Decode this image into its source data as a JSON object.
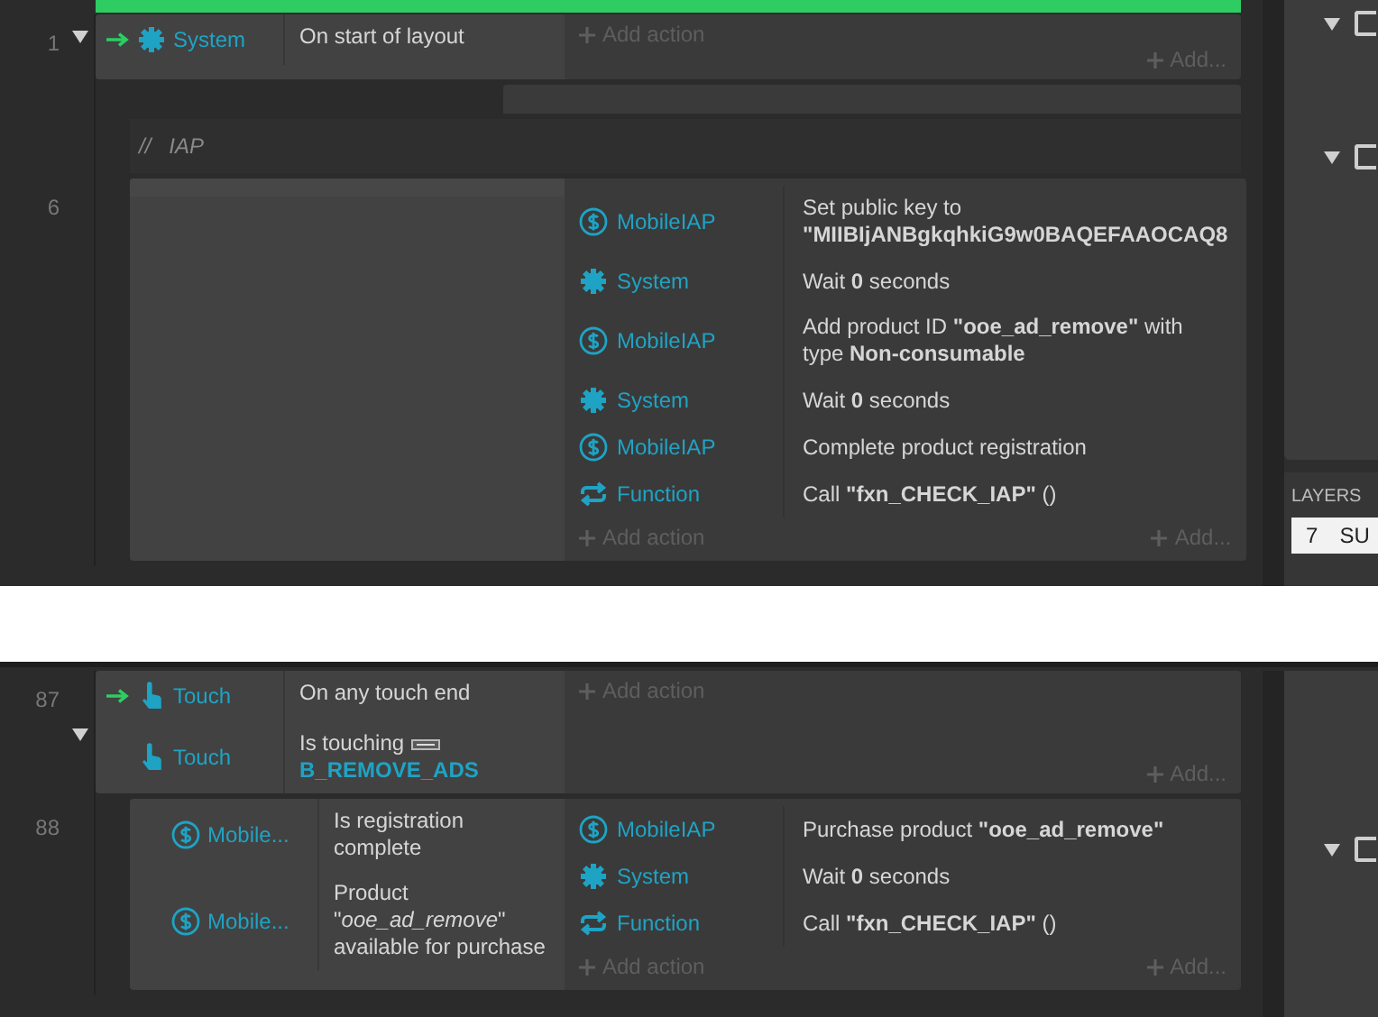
{
  "sections": [
    {
      "group_bar": true,
      "tree_toggles": [
        {
          "expanded": true,
          "checked": false
        },
        {
          "expanded": true,
          "checked": false
        }
      ],
      "layers": {
        "title": "LAYERS",
        "rows": [
          {
            "number": "7",
            "name": "SU",
            "selected": true
          }
        ]
      },
      "events": [
        {
          "kind": "event",
          "line": "1",
          "expanded": true,
          "conditions": [
            {
              "object": "System",
              "kind": "system",
              "trigger": true,
              "text": "On start of layout"
            }
          ],
          "add_action": "Add action",
          "add_more": "Add...",
          "children": [
            {
              "kind": "stub"
            },
            {
              "kind": "comment",
              "marker": "//",
              "text": "IAP"
            },
            {
              "kind": "event",
              "line": "6",
              "actions": [
                {
                  "object": "MobileIAP",
                  "kind": "iap",
                  "text": "Set public key to **\"MIIBIjANBgkqhkiG9w0BAQEFAAOCAQ8**"
                },
                {
                  "object": "System",
                  "kind": "system",
                  "text": "Wait **0** seconds"
                },
                {
                  "object": "MobileIAP",
                  "kind": "iap",
                  "text": "Add product ID **\"ooe_ad_remove\"** with type **Non-consumable**"
                },
                {
                  "object": "System",
                  "kind": "system",
                  "text": "Wait **0** seconds"
                },
                {
                  "object": "MobileIAP",
                  "kind": "iap",
                  "text": "Complete product registration"
                },
                {
                  "object": "Function",
                  "kind": "function",
                  "text": "Call **\"fxn_CHECK_IAP\"** ()"
                }
              ],
              "add_action": "Add action",
              "add_more": "Add..."
            }
          ]
        }
      ]
    },
    {
      "tree_toggles": [
        {
          "expanded": true,
          "checked": false
        }
      ],
      "events": [
        {
          "kind": "event",
          "line": "87",
          "expanded": true,
          "conditions": [
            {
              "object": "Touch",
              "kind": "touch",
              "trigger": true,
              "text": "On any touch end"
            },
            {
              "object": "Touch",
              "kind": "touch",
              "trigger": false,
              "text": "Is touching",
              "param": "B_REMOVE_ADS"
            }
          ],
          "add_action": "Add action",
          "add_more": "Add...",
          "children": [
            {
              "kind": "event",
              "line": "88",
              "conditions": [
                {
                  "object": "Mobile...",
                  "kind": "iap",
                  "trigger": false,
                  "text": "Is registration complete"
                },
                {
                  "object": "Mobile...",
                  "kind": "iap",
                  "trigger": false,
                  "text": "Product \"*ooe_ad_remove*\" available for purchase"
                }
              ],
              "actions": [
                {
                  "object": "MobileIAP",
                  "kind": "iap",
                  "text": "Purchase product **\"ooe_ad_remove\"**"
                },
                {
                  "object": "System",
                  "kind": "system",
                  "text": "Wait **0** seconds"
                },
                {
                  "object": "Function",
                  "kind": "function",
                  "text": "Call **\"fxn_CHECK_IAP\"** ()"
                }
              ],
              "add_action": "Add action",
              "add_more": "Add..."
            }
          ]
        }
      ]
    }
  ]
}
